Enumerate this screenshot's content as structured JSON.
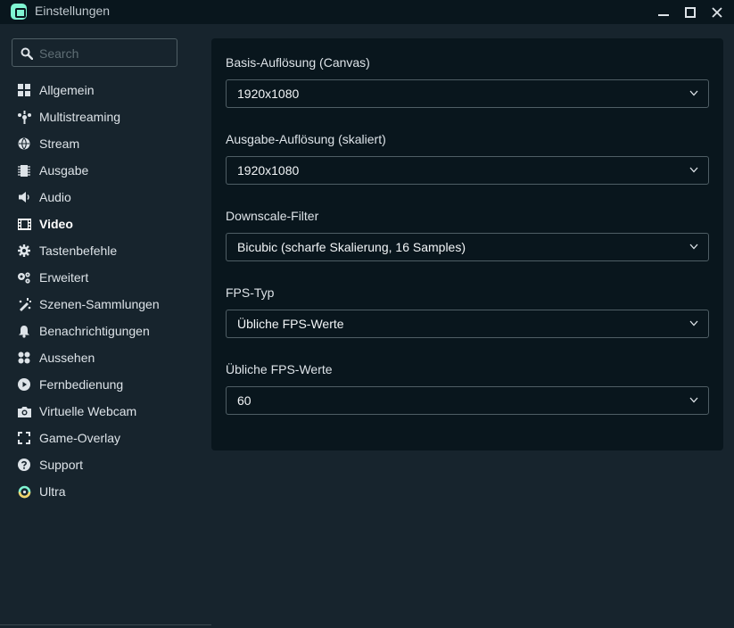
{
  "window": {
    "title": "Einstellungen"
  },
  "search": {
    "placeholder": "Search"
  },
  "sidebar": {
    "items": [
      {
        "label": "Allgemein",
        "icon": "grid-icon"
      },
      {
        "label": "Multistreaming",
        "icon": "multistream-icon"
      },
      {
        "label": "Stream",
        "icon": "globe-icon"
      },
      {
        "label": "Ausgabe",
        "icon": "chip-icon"
      },
      {
        "label": "Audio",
        "icon": "speaker-icon"
      },
      {
        "label": "Video",
        "icon": "film-icon",
        "active": true
      },
      {
        "label": "Tastenbefehle",
        "icon": "gear-icon"
      },
      {
        "label": "Erweitert",
        "icon": "gears-icon"
      },
      {
        "label": "Szenen-Sammlungen",
        "icon": "collection-icon"
      },
      {
        "label": "Benachrichtigungen",
        "icon": "bell-icon"
      },
      {
        "label": "Aussehen",
        "icon": "palette-icon"
      },
      {
        "label": "Fernbedienung",
        "icon": "play-circle-icon"
      },
      {
        "label": "Virtuelle Webcam",
        "icon": "camera-icon"
      },
      {
        "label": "Game-Overlay",
        "icon": "expand-icon"
      },
      {
        "label": "Support",
        "icon": "question-icon"
      },
      {
        "label": "Ultra",
        "icon": "ultra-icon"
      }
    ]
  },
  "video": {
    "fields": [
      {
        "label": "Basis-Auflösung (Canvas)",
        "value": "1920x1080"
      },
      {
        "label": "Ausgabe-Auflösung (skaliert)",
        "value": "1920x1080"
      },
      {
        "label": "Downscale-Filter",
        "value": "Bicubic (scharfe Skalierung, 16 Samples)"
      },
      {
        "label": "FPS-Typ",
        "value": "Übliche FPS-Werte"
      },
      {
        "label": "Übliche FPS-Werte",
        "value": "60"
      }
    ]
  },
  "colors": {
    "accent": "#80f5d2",
    "panel": "#09161d",
    "background": "#17242d"
  }
}
